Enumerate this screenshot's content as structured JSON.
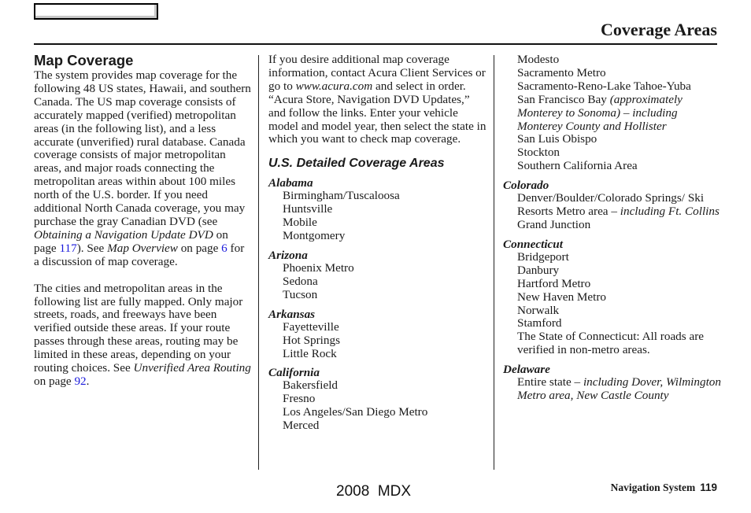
{
  "header": {
    "title": "Coverage Areas"
  },
  "left_column": {
    "heading": "Map Coverage",
    "para1": {
      "text_a": "The system provides map coverage for the following 48 US states, Hawaii, and southern Canada. The US map coverage consists of accurately mapped (verified) metropolitan areas (in the following list), and a less accurate (unverified) rural database. Canada coverage consists of major metropolitan areas, and major roads connecting the metropolitan areas within about 100 miles north of the U.S. border. If you need additional North Canada coverage, you may purchase the gray Canadian DVD (see ",
      "ref1_title": "Obtaining a Navigation Update DVD",
      "ref1_mid": " on page ",
      "ref1_page": "117",
      "text_b": "). See ",
      "ref2_title": "Map Overview",
      "ref2_mid": " on page ",
      "ref2_page": "6",
      "text_c": " for a discussion of map coverage."
    },
    "para2": {
      "text_a": "The cities and metropolitan areas in the following list are fully mapped. Only major streets, roads, and freeways have been verified outside these areas. If your route passes through these areas, routing may be limited in these areas, depending on your routing choices. See ",
      "ref_title": "Unverified Area Routing",
      "ref_mid": " on page ",
      "ref_page": "92",
      "text_b": "."
    }
  },
  "middle_column": {
    "intro": {
      "text_a": "If you desire additional map coverage information, contact Acura Client Services or go to ",
      "url": "www.acura.com",
      "text_b": " and select in order. “Acura Store, Navigation DVD Updates,” and follow the links. Enter your vehicle model and model year, then select the state in which you want to check map coverage."
    },
    "subheading": "U.S. Detailed Coverage Areas",
    "states": [
      {
        "name": "Alabama",
        "cities": [
          "Birmingham/Tuscaloosa",
          "Huntsville",
          "Mobile",
          "Montgomery"
        ]
      },
      {
        "name": "Arizona",
        "cities": [
          "Phoenix Metro",
          "Sedona",
          "Tucson"
        ]
      },
      {
        "name": "Arkansas",
        "cities": [
          "Fayetteville",
          "Hot Springs",
          "Little Rock"
        ]
      },
      {
        "name": "California",
        "cities": [
          "Bakersfield",
          "Fresno",
          "Los Angeles/San Diego Metro",
          "Merced"
        ]
      }
    ]
  },
  "right_column": {
    "california_cont": {
      "cities": [
        "Modesto",
        "Sacramento Metro",
        "Sacramento-Reno-Lake Tahoe-Yuba"
      ],
      "sf_bay": "San Francisco Bay ",
      "sf_bay_note": "(approximately Monterey to Sonoma) – including Monterey County and Hollister",
      "cities_after": [
        "San Luis Obispo",
        "Stockton",
        "Southern California Area"
      ]
    },
    "colorado": {
      "name": "Colorado",
      "denver": "Denver/Boulder/Colorado Springs/ Ski Resorts Metro area – ",
      "denver_note": "including Ft. Collins",
      "cities_after": [
        "Grand Junction"
      ]
    },
    "connecticut": {
      "name": "Connecticut",
      "cities": [
        "Bridgeport",
        "Danbury",
        "Hartford Metro",
        "New Haven Metro",
        "Norwalk",
        "Stamford",
        "The State of Connecticut: All roads are verified in non-metro areas."
      ]
    },
    "delaware": {
      "name": "Delaware",
      "entire": "Entire state – ",
      "entire_note": "including Dover, Wilmington Metro area, New Castle County"
    }
  },
  "footer": {
    "model": "2008  MDX",
    "section": "Navigation System",
    "page_number": "119"
  }
}
